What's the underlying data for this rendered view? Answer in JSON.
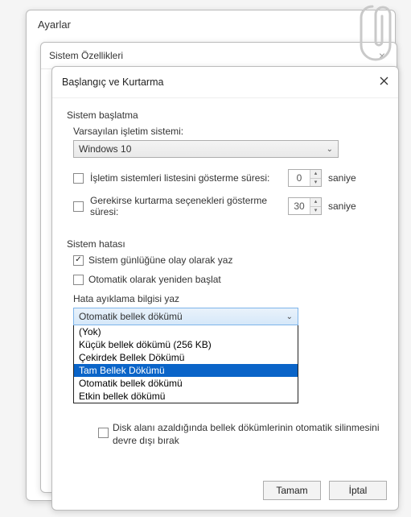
{
  "win1": {
    "title": "Ayarlar"
  },
  "win2": {
    "title": "Sistem Özellikleri"
  },
  "win3": {
    "title": "Başlangıç ve Kurtarma"
  },
  "startup": {
    "header": "Sistem başlatma",
    "default_os_label": "Varsayılan işletim sistemi:",
    "default_os_value": "Windows 10",
    "list_time_label": "İşletim sistemleri listesini gösterme süresi:",
    "list_time_value": "0",
    "recovery_time_label": "Gerekirse kurtarma seçenekleri gösterme süresi:",
    "recovery_time_value": "30",
    "unit": "saniye"
  },
  "failure": {
    "header": "Sistem hatası",
    "log_label": "Sistem günlüğüne olay olarak yaz",
    "restart_label": "Otomatik olarak yeniden başlat",
    "debug_label": "Hata ayıklama bilgisi yaz",
    "combo_selected": "Otomatik bellek dökümü",
    "options": [
      "(Yok)",
      "Küçük bellek dökümü (256 KB)",
      "Çekirdek Bellek Dökümü",
      "Tam Bellek Dökümü",
      "Otomatik bellek dökümü",
      "Etkin bellek dökümü"
    ],
    "highlighted_index": 3,
    "disk_label": "Disk alanı azaldığında bellek dökümlerinin otomatik silinmesini devre dışı bırak"
  },
  "buttons": {
    "ok": "Tamam",
    "cancel": "İptal"
  }
}
